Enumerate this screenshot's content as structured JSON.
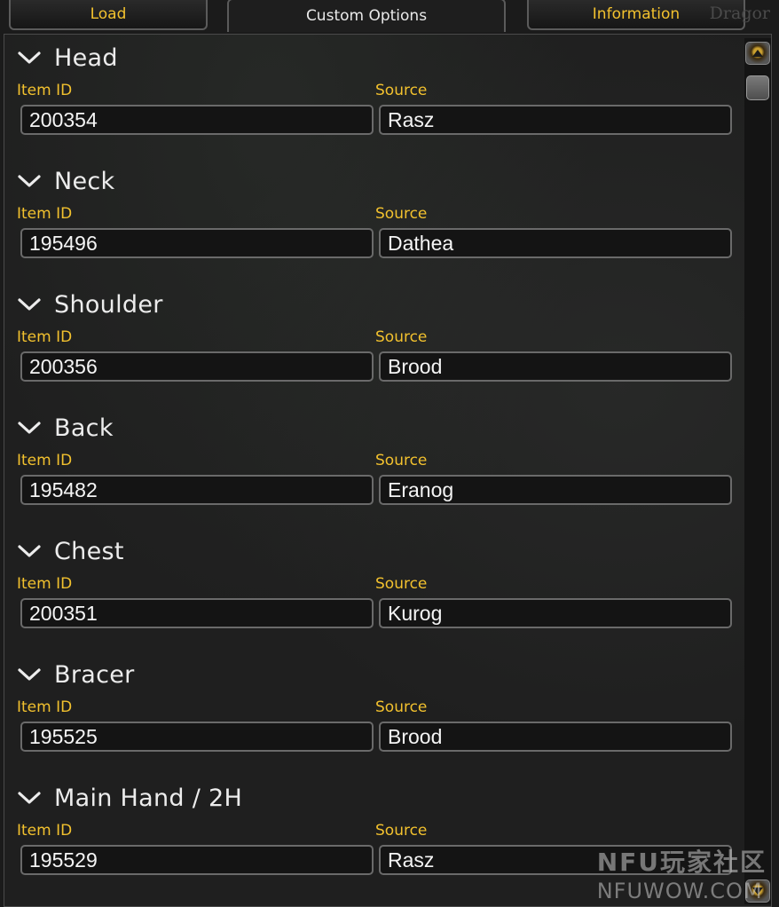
{
  "tabs": [
    {
      "label": "Load",
      "active": false
    },
    {
      "label": "Custom Options",
      "active": true
    },
    {
      "label": "Information",
      "active": false
    }
  ],
  "faded_heading": "Dragor",
  "field_labels": {
    "item_id": "Item ID",
    "source": "Source"
  },
  "slots": [
    {
      "name": "Head",
      "item_id": "200354",
      "source": "Rasz"
    },
    {
      "name": "Neck",
      "item_id": "195496",
      "source": "Dathea"
    },
    {
      "name": "Shoulder",
      "item_id": "200356",
      "source": "Brood"
    },
    {
      "name": "Back",
      "item_id": "195482",
      "source": "Eranog"
    },
    {
      "name": "Chest",
      "item_id": "200351",
      "source": "Kurog"
    },
    {
      "name": "Bracer",
      "item_id": "195525",
      "source": "Brood"
    },
    {
      "name": "Main Hand / 2H",
      "item_id": "195529",
      "source": "Rasz"
    }
  ],
  "watermark": {
    "line1": "NFU玩家社区",
    "line2": "NFUWOW.COM"
  },
  "colors": {
    "label_gold": "#f2c12e",
    "heading_white": "#ececec",
    "field_bg": "#141414"
  },
  "icons": {
    "collapse": "chevron-down-icon",
    "scroll_up": "scroll-up-arrow-icon",
    "scroll_down": "scroll-down-arrow-icon"
  }
}
